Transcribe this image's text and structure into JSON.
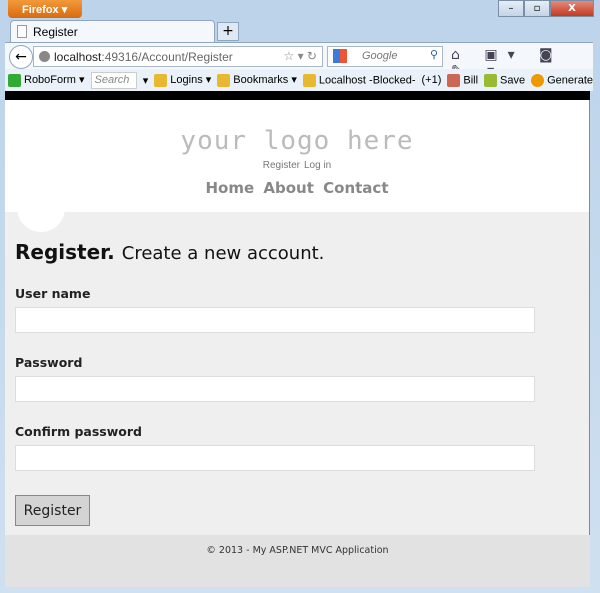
{
  "browser": {
    "menu_button": "Firefox",
    "tab_title": "Register",
    "new_tab": "+",
    "url_host": "localhost",
    "url_rest": ":49316/Account/Register",
    "search_placeholder": "Google",
    "window_buttons": [
      "–",
      "▫",
      "X"
    ]
  },
  "bookmarks": {
    "roboform": "RoboForm",
    "search_placeholder": "Search",
    "items": [
      "Logins",
      "Bookmarks",
      "Localhost -Blocked-",
      "(+1)",
      "Bill",
      "Save",
      "Generate"
    ]
  },
  "site": {
    "logo": "your logo here",
    "login_links": [
      "Register",
      "Log in"
    ],
    "menu": [
      "Home",
      "About",
      "Contact"
    ]
  },
  "form": {
    "title": "Register.",
    "subtitle": "Create a new account.",
    "fields": [
      {
        "label": "User name",
        "value": ""
      },
      {
        "label": "Password",
        "value": ""
      },
      {
        "label": "Confirm password",
        "value": ""
      }
    ],
    "submit": "Register"
  },
  "footer": {
    "text": "© 2013 - My ASP.NET MVC Application"
  }
}
